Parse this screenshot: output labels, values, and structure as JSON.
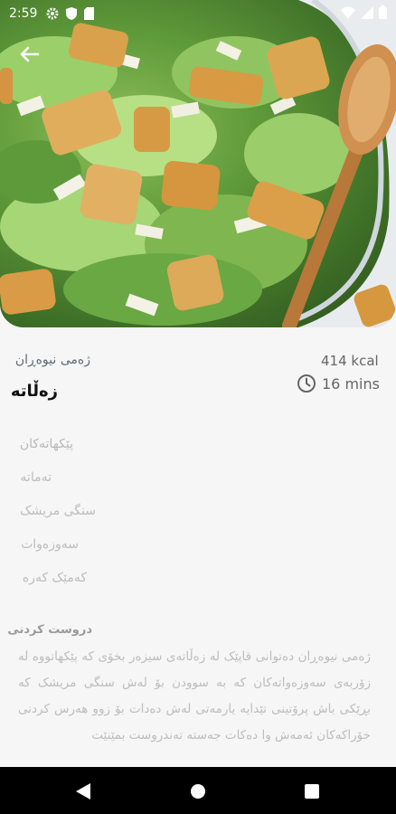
{
  "status_bar": {
    "time": "2:59",
    "icons": [
      "gear-icon",
      "shield-icon",
      "sd-card-icon",
      "wifi-icon",
      "cellular-icon",
      "battery-icon"
    ]
  },
  "header": {
    "back_icon": "arrow-left-icon"
  },
  "recipe": {
    "category": "ژەمی نیوەڕان",
    "title": "زەڵاتە",
    "calories": "414 kcal",
    "duration": "16 mins",
    "duration_icon": "clock-icon"
  },
  "ingredients": {
    "title": "پێکهاتەکان",
    "items": [
      "تەماتە",
      "سنگی مریشک",
      "سەوزەوات",
      "کەمێک کەرە"
    ]
  },
  "method": {
    "title": "دروست کردنی",
    "text": "ژەمی نیوەڕان دەتوانی قاپێک لە زەڵاتەی سیزەر بخۆی کە پێکهاتووە لە زۆربەی سەوزەواتەکان کە بە سوودن بۆ لەش سنگی مریشک کە بڕێکی باش پرۆتینی تێدایە یارمەتی لەش دەدات بۆ زوو هەرس کردنی خۆراکەکان ئەمەش وا دەکات جەستە تەندروست بمێنێت"
  },
  "nav": {
    "icons": [
      "back-triangle-icon",
      "home-circle-icon",
      "recents-square-icon"
    ]
  },
  "colors": {
    "background": "#f6f6f6",
    "title": "#111111",
    "muted": "#bdbdbd",
    "navbar": "#000000"
  }
}
